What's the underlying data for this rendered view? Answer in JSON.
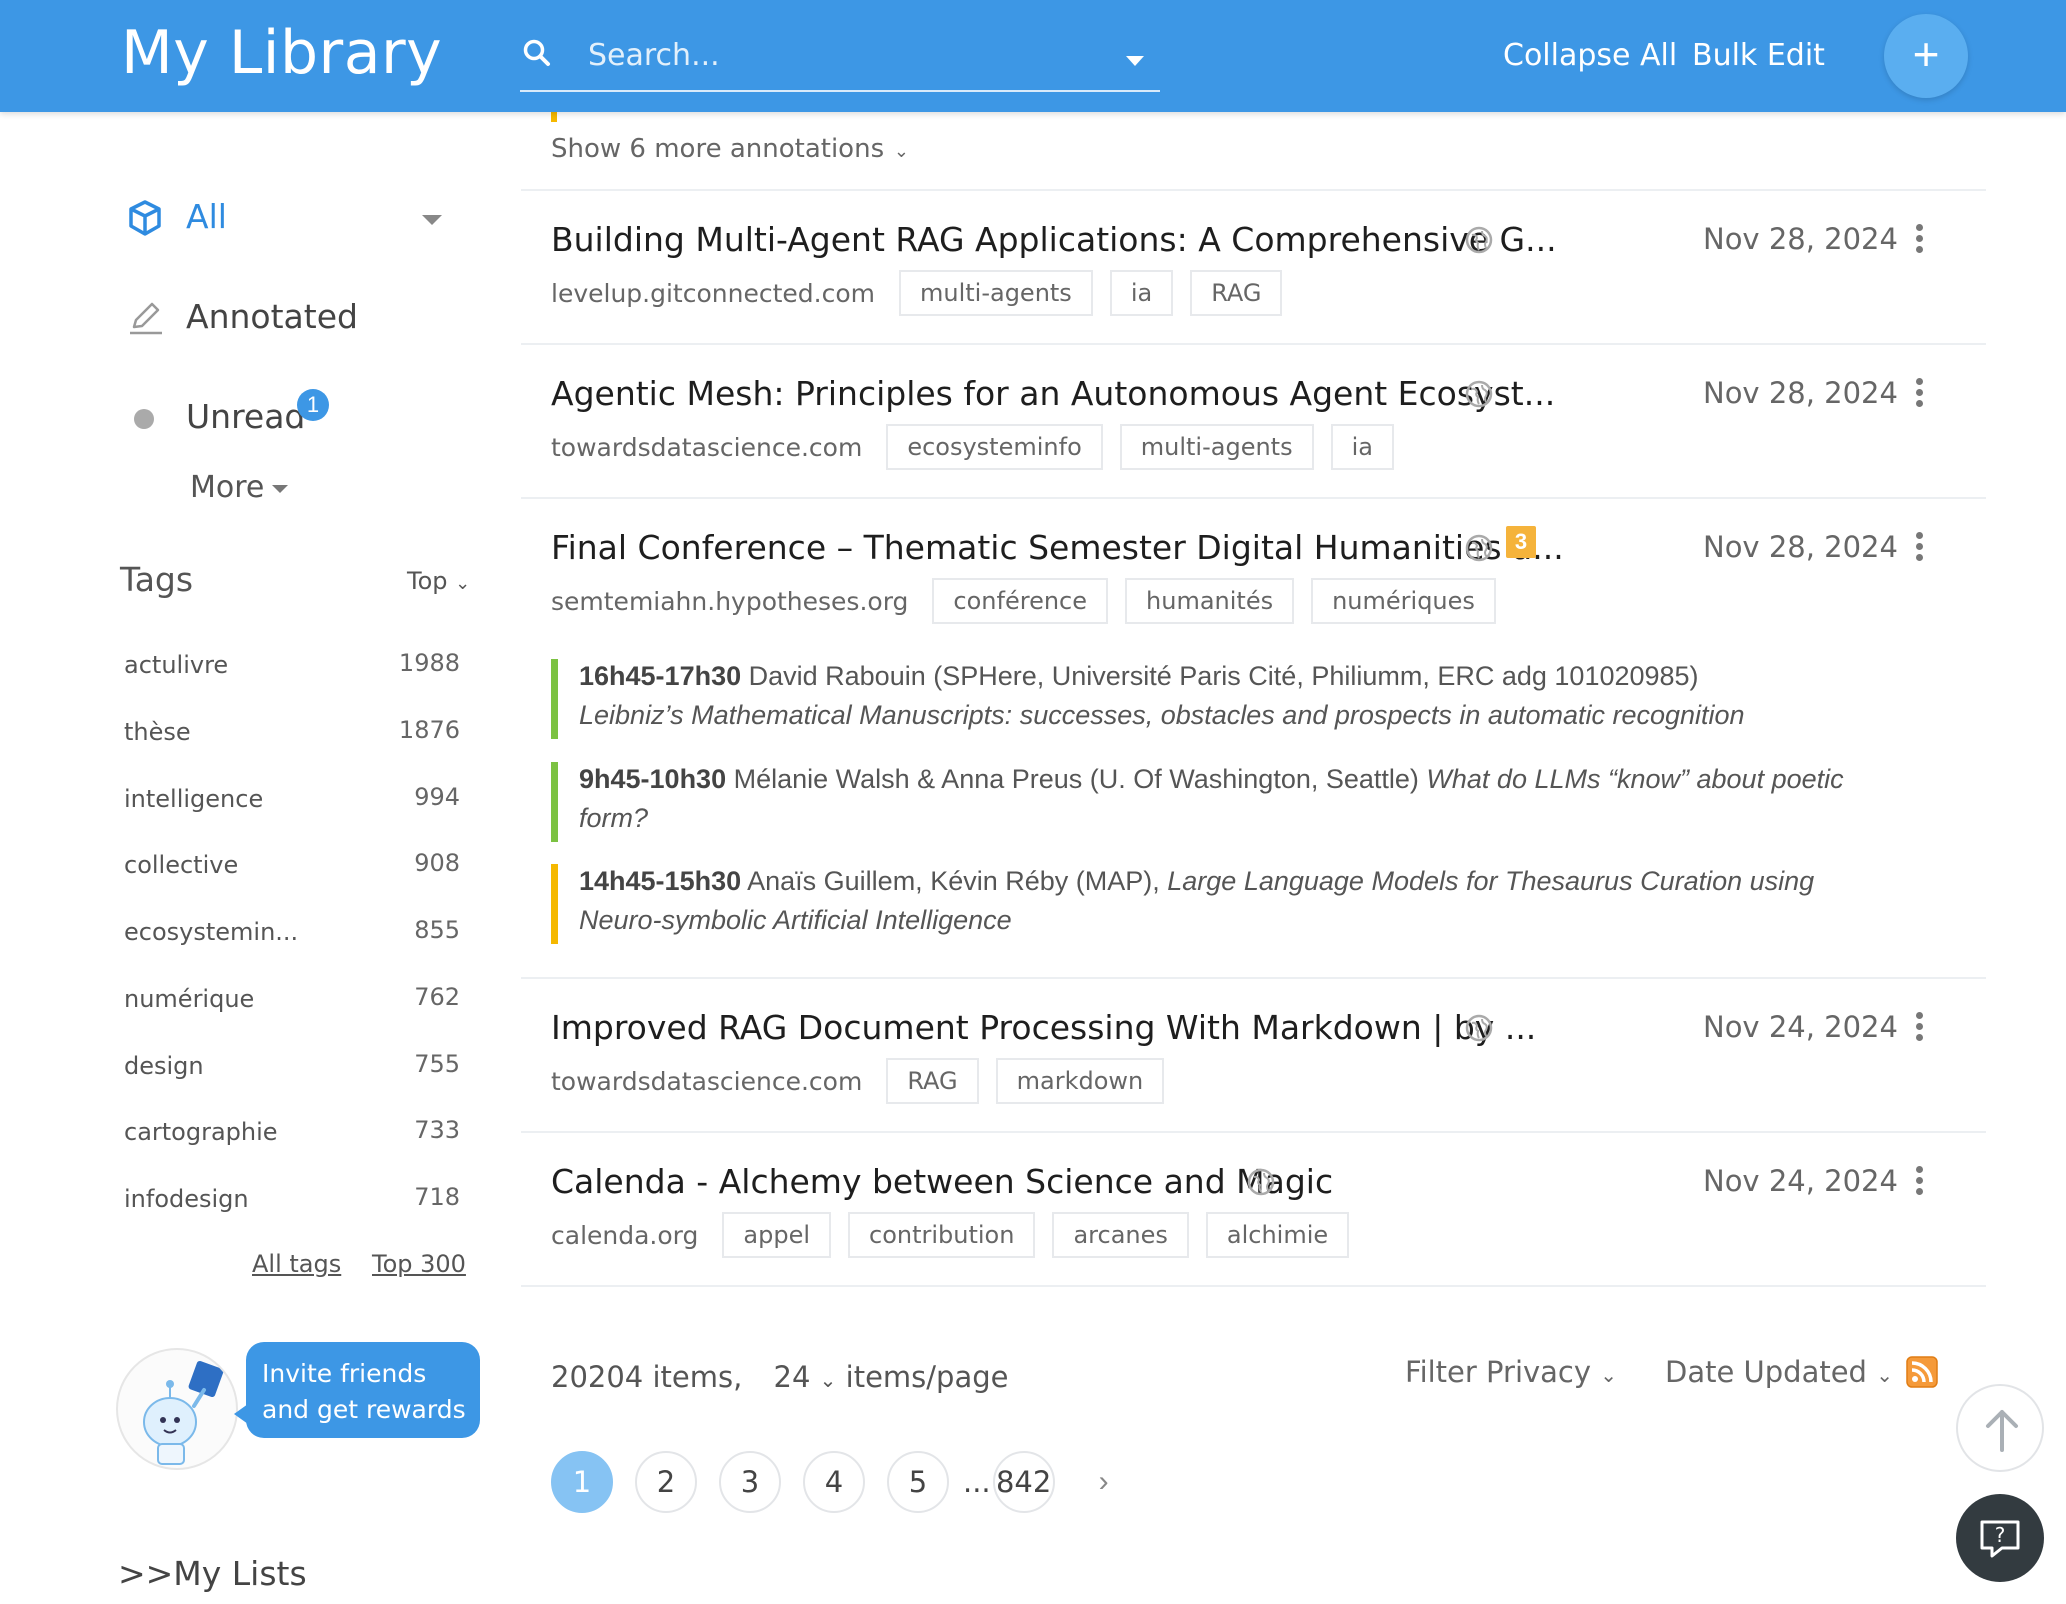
{
  "header": {
    "title": "My Library",
    "search_placeholder": "Search...",
    "collapse_all": "Collapse All",
    "bulk_edit": "Bulk Edit",
    "add": "+"
  },
  "sidebar": {
    "all": "All",
    "annotated": "Annotated",
    "unread": "Unread",
    "unread_badge": "1",
    "more": "More",
    "tags_title": "Tags",
    "tags_sort": "Top",
    "tags": [
      {
        "name": "actulivre",
        "count": "1988"
      },
      {
        "name": "thèse",
        "count": "1876"
      },
      {
        "name": "intelligence",
        "count": "994"
      },
      {
        "name": "collective",
        "count": "908"
      },
      {
        "name": "ecosystemin...",
        "count": "855"
      },
      {
        "name": "numérique",
        "count": "762"
      },
      {
        "name": "design",
        "count": "755"
      },
      {
        "name": "cartographie",
        "count": "733"
      },
      {
        "name": "infodesign",
        "count": "718"
      }
    ],
    "all_tags": "All tags",
    "top_300": "Top 300",
    "invite_line1": "Invite friends",
    "invite_line2": "and get rewards",
    "my_lists": ">>My Lists"
  },
  "list": {
    "show_more": "Show 6 more annotations",
    "items": [
      {
        "title": "Building Multi-Agent RAG Applications: A Comprehensive G...",
        "date": "Nov 28, 2024",
        "domain": "levelup.gitconnected.com",
        "tags": [
          "multi-agents",
          "ia",
          "RAG"
        ]
      },
      {
        "title": "Agentic Mesh: Principles for an Autonomous Agent Ecosyst...",
        "date": "Nov 28, 2024",
        "domain": "towardsdatascience.com",
        "tags": [
          "ecosysteminfo",
          "multi-agents",
          "ia"
        ]
      },
      {
        "title": "Final Conference – Thematic Semester Digital Humanities a...",
        "date": "Nov 28, 2024",
        "domain": "semtemiahn.hypotheses.org",
        "tags": [
          "conférence",
          "humanités",
          "numériques"
        ],
        "annotation_count": "3"
      },
      {
        "title": "Improved RAG Document Processing With Markdown | by ...",
        "date": "Nov 24, 2024",
        "domain": "towardsdatascience.com",
        "tags": [
          "RAG",
          "markdown"
        ]
      },
      {
        "title": "Calenda - Alchemy between Science and Magic",
        "date": "Nov 24, 2024",
        "domain": "calenda.org",
        "tags": [
          "appel",
          "contribution",
          "arcanes",
          "alchimie"
        ]
      }
    ],
    "annotations": [
      {
        "time": "16h45-17h30",
        "text": " David Rabouin (SPHere, Université Paris Cité, Philiumm, ERC adg 101020985)",
        "italic": " Leibniz’s Mathematical Manuscripts: successes, obstacles and prospects in automatic recognition",
        "color": "#7cc242"
      },
      {
        "time": "9h45-10h30",
        "text": " Mélanie Walsh & Anna Preus (U. Of Washington, Seattle) ",
        "italic": "What do LLMs “know” about poetic form?",
        "color": "#7cc242"
      },
      {
        "time": "14h45-15h30",
        "text": " Anaïs Guillem, Kévin Réby (MAP), ",
        "italic": "Large Language Models for Thesaurus Curation using Neuro-symbolic Artificial Intelligence",
        "color": "#f5b800"
      }
    ]
  },
  "footer": {
    "items_count": "20204 items,",
    "per_page_value": "24",
    "per_page_label": "items/page",
    "filter_privacy": "Filter Privacy",
    "date_updated": "Date Updated",
    "pages": [
      "1",
      "2",
      "3",
      "4",
      "5"
    ],
    "ellipsis": "...",
    "last_page": "842",
    "next": "›"
  },
  "colors": {
    "header_bg": "#3d97e5",
    "accent": "#2f8be0",
    "annotation_green": "#7cc242",
    "annotation_yellow": "#f5b800",
    "badge_orange": "#f5b33b"
  }
}
